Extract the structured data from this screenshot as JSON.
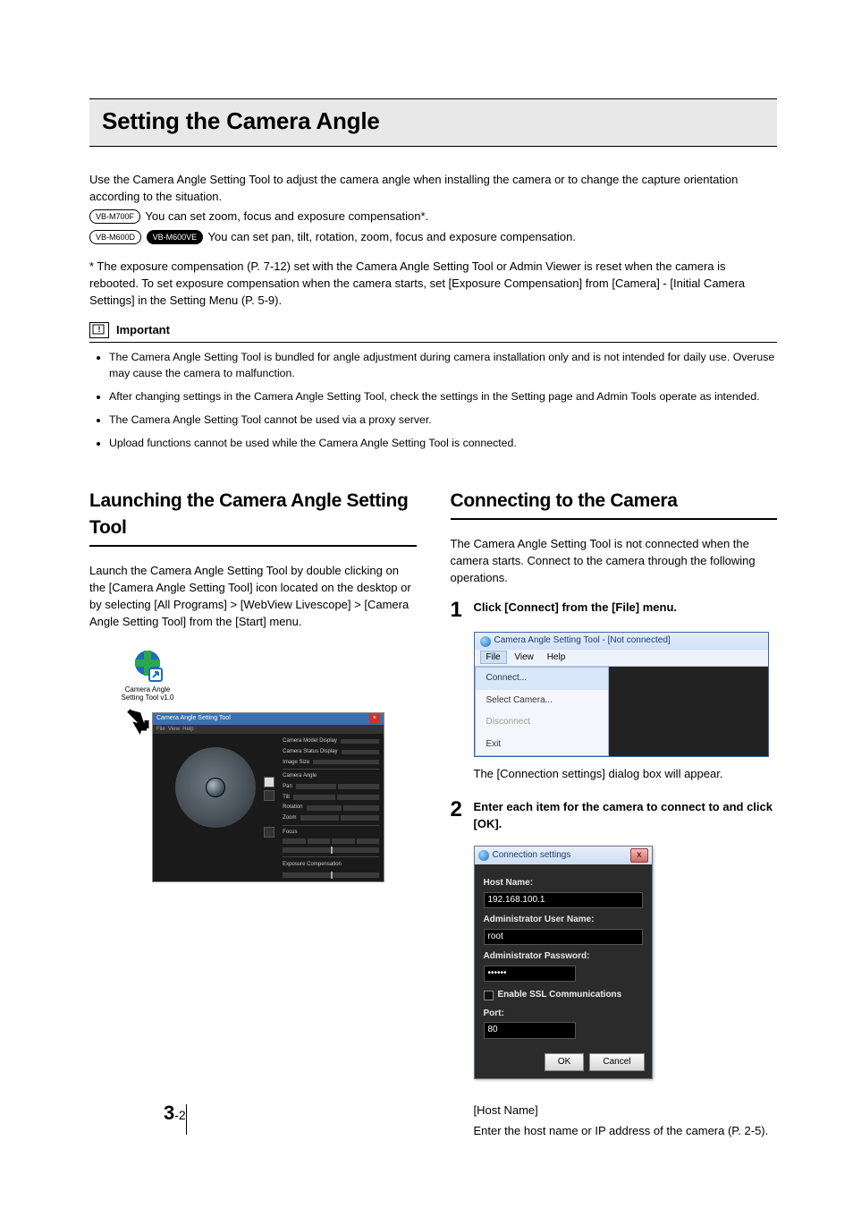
{
  "page": {
    "chapter": "3",
    "page": "-2"
  },
  "title": "Setting the Camera Angle",
  "intro": {
    "p1": "Use the Camera Angle Setting Tool to adjust the camera angle when installing the camera or to change the capture orientation according to the situation.",
    "badge1": "VB-M700F",
    "p2": " You can set zoom, focus and exposure compensation*.",
    "badge2": "VB-M600D",
    "badge3": "VB-M600VE",
    "p3": " You can set pan, tilt, rotation, zoom, focus and exposure compensation.",
    "note": "* The exposure compensation (P. 7-12) set with the Camera Angle Setting Tool or Admin Viewer is reset when the camera is rebooted. To set exposure compensation when the camera starts, set [Exposure Compensation] from [Camera] - [Initial Camera Settings] in the Setting Menu (P. 5-9)."
  },
  "important": {
    "label": "Important",
    "items": [
      "The Camera Angle Setting Tool is bundled for angle adjustment during camera installation only and is not intended for daily use. Overuse may cause the camera to malfunction.",
      "After changing settings in the Camera Angle Setting Tool, check the settings in the Setting page and Admin Tools operate as intended.",
      "The Camera Angle Setting Tool cannot be used via a proxy server.",
      "Upload functions cannot be used while the Camera Angle Setting Tool is connected."
    ]
  },
  "left": {
    "heading": "Launching the Camera Angle Setting Tool",
    "para": "Launch the Camera Angle Setting Tool by double clicking on the [Camera Angle Setting Tool] icon located on the desktop or by selecting [All Programs] > [WebView Livescope] > [Camera Angle Setting Tool] from the [Start] menu.",
    "iconLabel1": "Camera Angle",
    "iconLabel2": "Setting Tool v1.0",
    "toolTitle": "Camera Angle Setting Tool",
    "sideLabels": {
      "a": "Camera Model Display",
      "b": "Camera Status Display",
      "c": "Image Size",
      "d": "Camera Angle",
      "e": "Pan",
      "f": "Tilt",
      "g": "Rotation",
      "h": "Zoom",
      "i": "Focus",
      "j": "Exposure Compensation"
    }
  },
  "right": {
    "heading": "Connecting to the Camera",
    "para": "The Camera Angle Setting Tool is not connected when the camera starts. Connect to the camera through the following operations.",
    "step1": {
      "text": "Click [Connect] from the [File] menu."
    },
    "menuWindow": {
      "title": "Camera Angle Setting Tool - [Not connected]",
      "menu": {
        "file": "File",
        "view": "View",
        "help": "Help"
      },
      "items": {
        "connect": "Connect...",
        "select": "Select Camera...",
        "disconnect": "Disconnect",
        "exit": "Exit"
      }
    },
    "afterMenu": "The [Connection settings] dialog box will appear.",
    "step2": {
      "text": "Enter each item for the camera to connect to and click [OK]."
    },
    "dialog": {
      "title": "Connection settings",
      "close": "x",
      "host": {
        "label": "Host Name:",
        "value": "192.168.100.1"
      },
      "user": {
        "label": "Administrator User Name:",
        "value": "root"
      },
      "pass": {
        "label": "Administrator Password:",
        "value": "••••••"
      },
      "ssl": "Enable SSL Communications",
      "port": {
        "label": "Port:",
        "value": "80"
      },
      "ok": "OK",
      "cancel": "Cancel"
    },
    "def": {
      "name": "[Host Name]",
      "desc": "Enter the host name or IP address of the camera (P. 2-5)."
    }
  }
}
